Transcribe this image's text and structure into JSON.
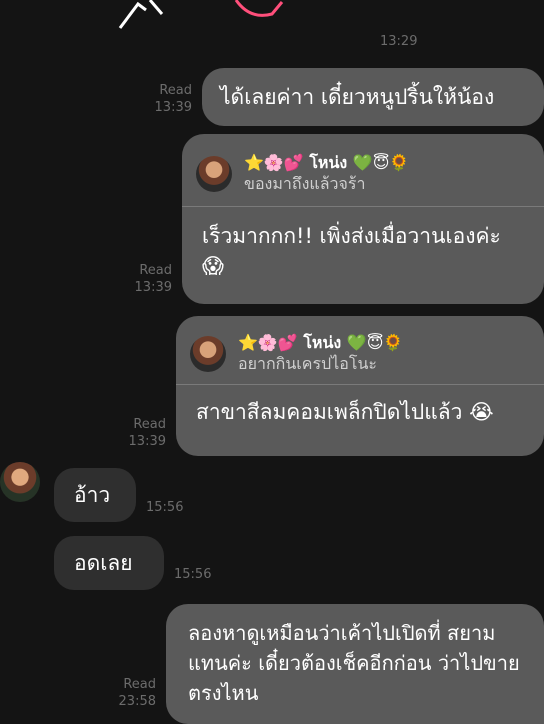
{
  "top_time": "13:29",
  "messages": [
    {
      "status": "Read",
      "time": "13:39",
      "text": "ได้เลยค่าา เดี๋ยวหนูปริ้นให้น้อง"
    },
    {
      "status": "Read",
      "time": "13:39",
      "quote_name": "⭐🌸💕 โหน่ง 💚😇🌻",
      "quote_text": "ของมาถึงแล้วจร้า",
      "text": "เร็วมากกก!! เพิ่งส่งเมื่อวานเองค่ะ 😱"
    },
    {
      "status": "Read",
      "time": "13:39",
      "quote_name": "⭐🌸💕 โหน่ง 💚😇🌻",
      "quote_text": "อยากกินเครปไอโนะ",
      "text": "สาขาสีลมคอมเพล็กปิดไปแล้ว 😭"
    },
    {
      "time": "15:56",
      "text": "อ้าว"
    },
    {
      "time": "15:56",
      "text": "อดเลย"
    },
    {
      "status": "Read",
      "time": "23:58",
      "text": "ลองหาดูเหมือนว่าเค้าไปเปิดที่ สยามแทนค่ะ เดี๋ยวต้องเช็คอีกก่อน ว่าไปขายตรงไหน"
    }
  ]
}
